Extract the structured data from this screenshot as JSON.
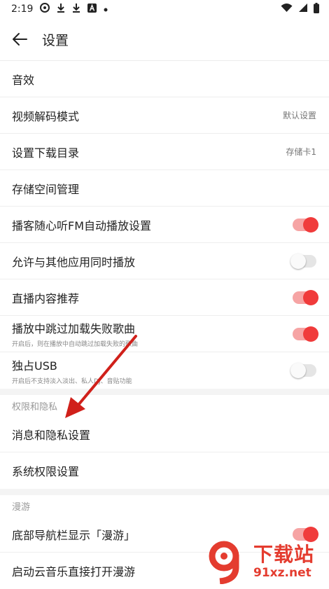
{
  "status": {
    "time": "2:19",
    "icons": [
      "netease-icon",
      "download-icon",
      "download-icon",
      "a-icon",
      "dot-icon"
    ],
    "right_icons": [
      "wifi-icon",
      "signal-icon",
      "battery-icon"
    ]
  },
  "header": {
    "title": "设置"
  },
  "settings": [
    {
      "label": "音效",
      "value": "",
      "type": "plain"
    },
    {
      "label": "视频解码模式",
      "value": "默认设置",
      "type": "value"
    },
    {
      "label": "设置下载目录",
      "value": "存储卡1",
      "type": "value"
    },
    {
      "label": "存储空间管理",
      "value": "",
      "type": "plain"
    },
    {
      "label": "播客随心听FM自动播放设置",
      "type": "toggle",
      "on": true
    },
    {
      "label": "允许与其他应用同时播放",
      "type": "toggle",
      "on": false
    },
    {
      "label": "直播内容推荐",
      "type": "toggle",
      "on": true
    },
    {
      "label": "播放中跳过加载失败歌曲",
      "sub": "开启后，则在播放中自动跳过加载失败的歌曲",
      "type": "toggle",
      "on": true
    },
    {
      "label": "独占USB",
      "sub": "开启后不支持淡入淡出、私人DJ、音贴功能",
      "type": "toggle",
      "on": false
    }
  ],
  "privacy": {
    "header": "权限和隐私",
    "items": [
      {
        "label": "消息和隐私设置"
      },
      {
        "label": "系统权限设置"
      }
    ]
  },
  "roam": {
    "header": "漫游",
    "items": [
      {
        "label": "底部导航栏显示「漫游」",
        "type": "toggle",
        "on": true
      },
      {
        "label": "启动云音乐直接打开漫游"
      }
    ]
  },
  "watermark": {
    "cn": "下载站",
    "en": "91xz.net",
    "mark": "9"
  },
  "colors": {
    "accent": "#f03b3b",
    "toggle_track_on": "#f6a4a4",
    "arrow": "#d0201a"
  }
}
